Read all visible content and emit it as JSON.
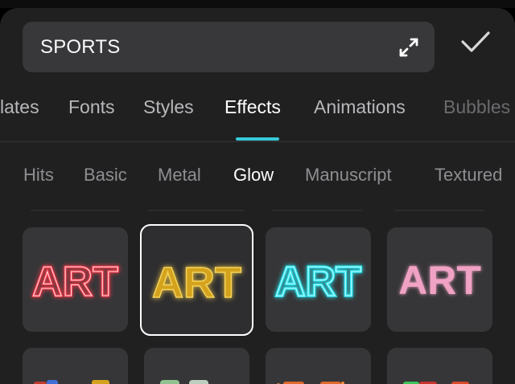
{
  "search": {
    "value": "SPORTS",
    "expand_icon": "expand-icon"
  },
  "confirm_icon": "check-icon",
  "tabs": [
    {
      "label": "lates",
      "state": "normal"
    },
    {
      "label": "Fonts",
      "state": "normal"
    },
    {
      "label": "Styles",
      "state": "normal"
    },
    {
      "label": "Effects",
      "state": "active"
    },
    {
      "label": "Animations",
      "state": "normal"
    },
    {
      "label": "Bubbles",
      "state": "faded"
    }
  ],
  "subtabs": [
    {
      "label": "Hits",
      "state": "normal"
    },
    {
      "label": "Basic",
      "state": "normal"
    },
    {
      "label": "Metal",
      "state": "normal"
    },
    {
      "label": "Glow",
      "state": "active"
    },
    {
      "label": "Manuscript",
      "state": "normal"
    },
    {
      "label": "Textured",
      "state": "normal"
    }
  ],
  "tiles": [
    {
      "text": "ART",
      "style": "red-neon-outline",
      "color": "#ff3b4b",
      "selected": false
    },
    {
      "text": "ART",
      "style": "gold-glow",
      "color": "#e0b324",
      "selected": true
    },
    {
      "text": "ART",
      "style": "cyan-neon-outline",
      "color": "#2ce6f0",
      "selected": false
    },
    {
      "text": "ART",
      "style": "pink-soft-glow",
      "color": "#f0a2c4",
      "selected": false
    }
  ],
  "colors": {
    "accent": "#37c9d9",
    "panel": "#202021",
    "tile": "#363638",
    "search_bg": "#38383a"
  }
}
